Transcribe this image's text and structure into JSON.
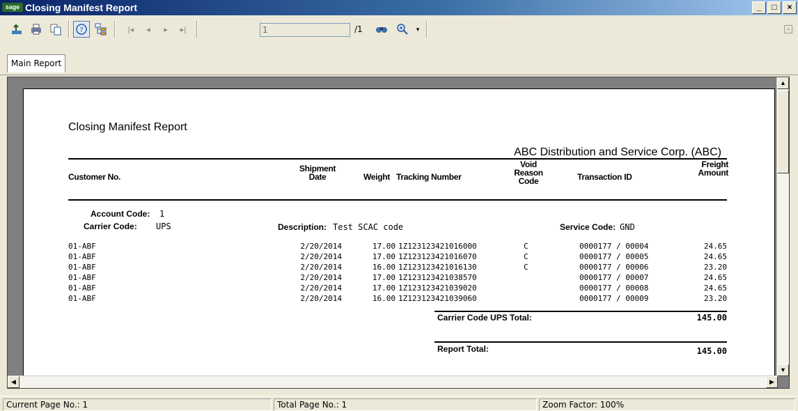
{
  "window": {
    "title": "Closing Manifest Report",
    "logo": "sage"
  },
  "toolbar": {
    "page_value": "1",
    "page_of": "/1",
    "icons": [
      "export-icon",
      "print-icon",
      "copy-icon",
      "help-icon",
      "group-tree-icon",
      "first-page-icon",
      "prev-page-icon",
      "next-page-icon",
      "last-page-icon",
      "search-icon",
      "zoom-icon"
    ]
  },
  "tabs": [
    {
      "label": "Main Report"
    }
  ],
  "report": {
    "title": "Closing Manifest Report",
    "company": "ABC Distribution and Service Corp. (ABC)",
    "columns": {
      "customer": "Customer No.",
      "ship_date": [
        "Shipment",
        "Date"
      ],
      "weight": "Weight",
      "tracking": "Tracking Number",
      "void": [
        "Void",
        "Reason",
        "Code"
      ],
      "txn": "Transaction ID",
      "freight": [
        "Freight",
        "Amount"
      ]
    },
    "group": {
      "account_label": "Account Code:",
      "account_value": "1",
      "carrier_label": "Carrier Code:",
      "carrier_value": "UPS",
      "desc_label": "Description:",
      "desc_value": "Test SCAC code",
      "service_label": "Service Code:",
      "service_value": "GND"
    },
    "rows": [
      {
        "customer": "01-ABF",
        "date": "2/20/2014",
        "weight": "17.00",
        "tracking": "1Z123123421016000",
        "void": "C",
        "txn": "0000177 / 00004",
        "amount": "24.65"
      },
      {
        "customer": "01-ABF",
        "date": "2/20/2014",
        "weight": "17.00",
        "tracking": "1Z123123421016070",
        "void": "C",
        "txn": "0000177 / 00005",
        "amount": "24.65"
      },
      {
        "customer": "01-ABF",
        "date": "2/20/2014",
        "weight": "16.00",
        "tracking": "1Z123123421016130",
        "void": "C",
        "txn": "0000177 / 00006",
        "amount": "23.20"
      },
      {
        "customer": "01-ABF",
        "date": "2/20/2014",
        "weight": "17.00",
        "tracking": "1Z123123421038570",
        "void": "",
        "txn": "0000177 / 00007",
        "amount": "24.65"
      },
      {
        "customer": "01-ABF",
        "date": "2/20/2014",
        "weight": "17.00",
        "tracking": "1Z123123421039020",
        "void": "",
        "txn": "0000177 / 00008",
        "amount": "24.65"
      },
      {
        "customer": "01-ABF",
        "date": "2/20/2014",
        "weight": "16.00",
        "tracking": "1Z123123421039060",
        "void": "",
        "txn": "0000177 / 00009",
        "amount": "23.20"
      }
    ],
    "carrier_total_label": "Carrier Code UPS Total:",
    "carrier_total_value": "145.00",
    "report_total_label": "Report Total:",
    "report_total_value": "145.00"
  },
  "status": {
    "current_page": "Current Page No.: 1",
    "total_page": "Total Page No.: 1",
    "zoom": "Zoom Factor: 100%"
  }
}
